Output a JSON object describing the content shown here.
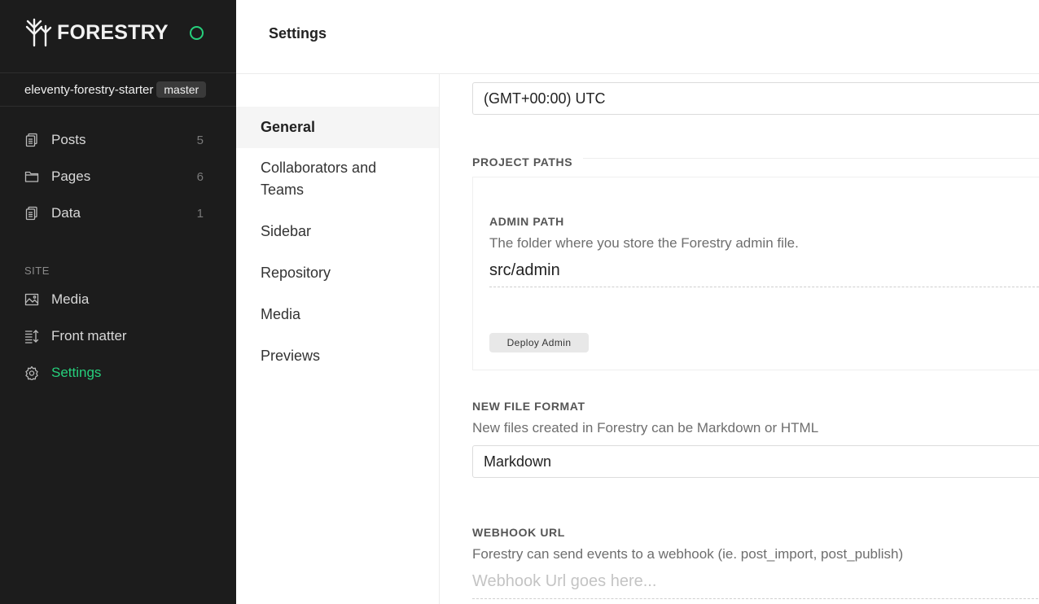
{
  "sidebar": {
    "logo_text": "FORESTRY",
    "project_name": "eleventy-forestry-starter",
    "branch": "master",
    "status_color": "#26d07c",
    "content_items": [
      {
        "label": "Posts",
        "count": "5",
        "icon": "posts-icon"
      },
      {
        "label": "Pages",
        "count": "6",
        "icon": "folder-icon"
      },
      {
        "label": "Data",
        "count": "1",
        "icon": "data-icon"
      }
    ],
    "site_heading": "SITE",
    "site_items": [
      {
        "label": "Media",
        "icon": "image-icon"
      },
      {
        "label": "Front matter",
        "icon": "front-matter-icon"
      },
      {
        "label": "Settings",
        "icon": "gear-icon",
        "active": true
      }
    ]
  },
  "header": {
    "title": "Settings"
  },
  "settings_nav": {
    "items": [
      "General",
      "Collaborators and Teams",
      "Sidebar",
      "Repository",
      "Media",
      "Previews"
    ],
    "active": "General"
  },
  "general": {
    "timezone_value": "(GMT+00:00) UTC",
    "project_paths_label": "PROJECT PATHS",
    "admin_path": {
      "label": "ADMIN PATH",
      "help": "The folder where you store the Forestry admin file.",
      "value": "src/admin"
    },
    "deploy_admin_label": "Deploy Admin",
    "new_file_format": {
      "label": "NEW FILE FORMAT",
      "help": "New files created in Forestry can be Markdown or HTML",
      "value": "Markdown"
    },
    "webhook": {
      "label": "WEBHOOK URL",
      "help": "Forestry can send events to a webhook (ie. post_import, post_publish)",
      "placeholder": "Webhook Url goes here..."
    }
  },
  "colors": {
    "sidebar_bg": "#1c1c1c",
    "accent": "#26d07c"
  }
}
